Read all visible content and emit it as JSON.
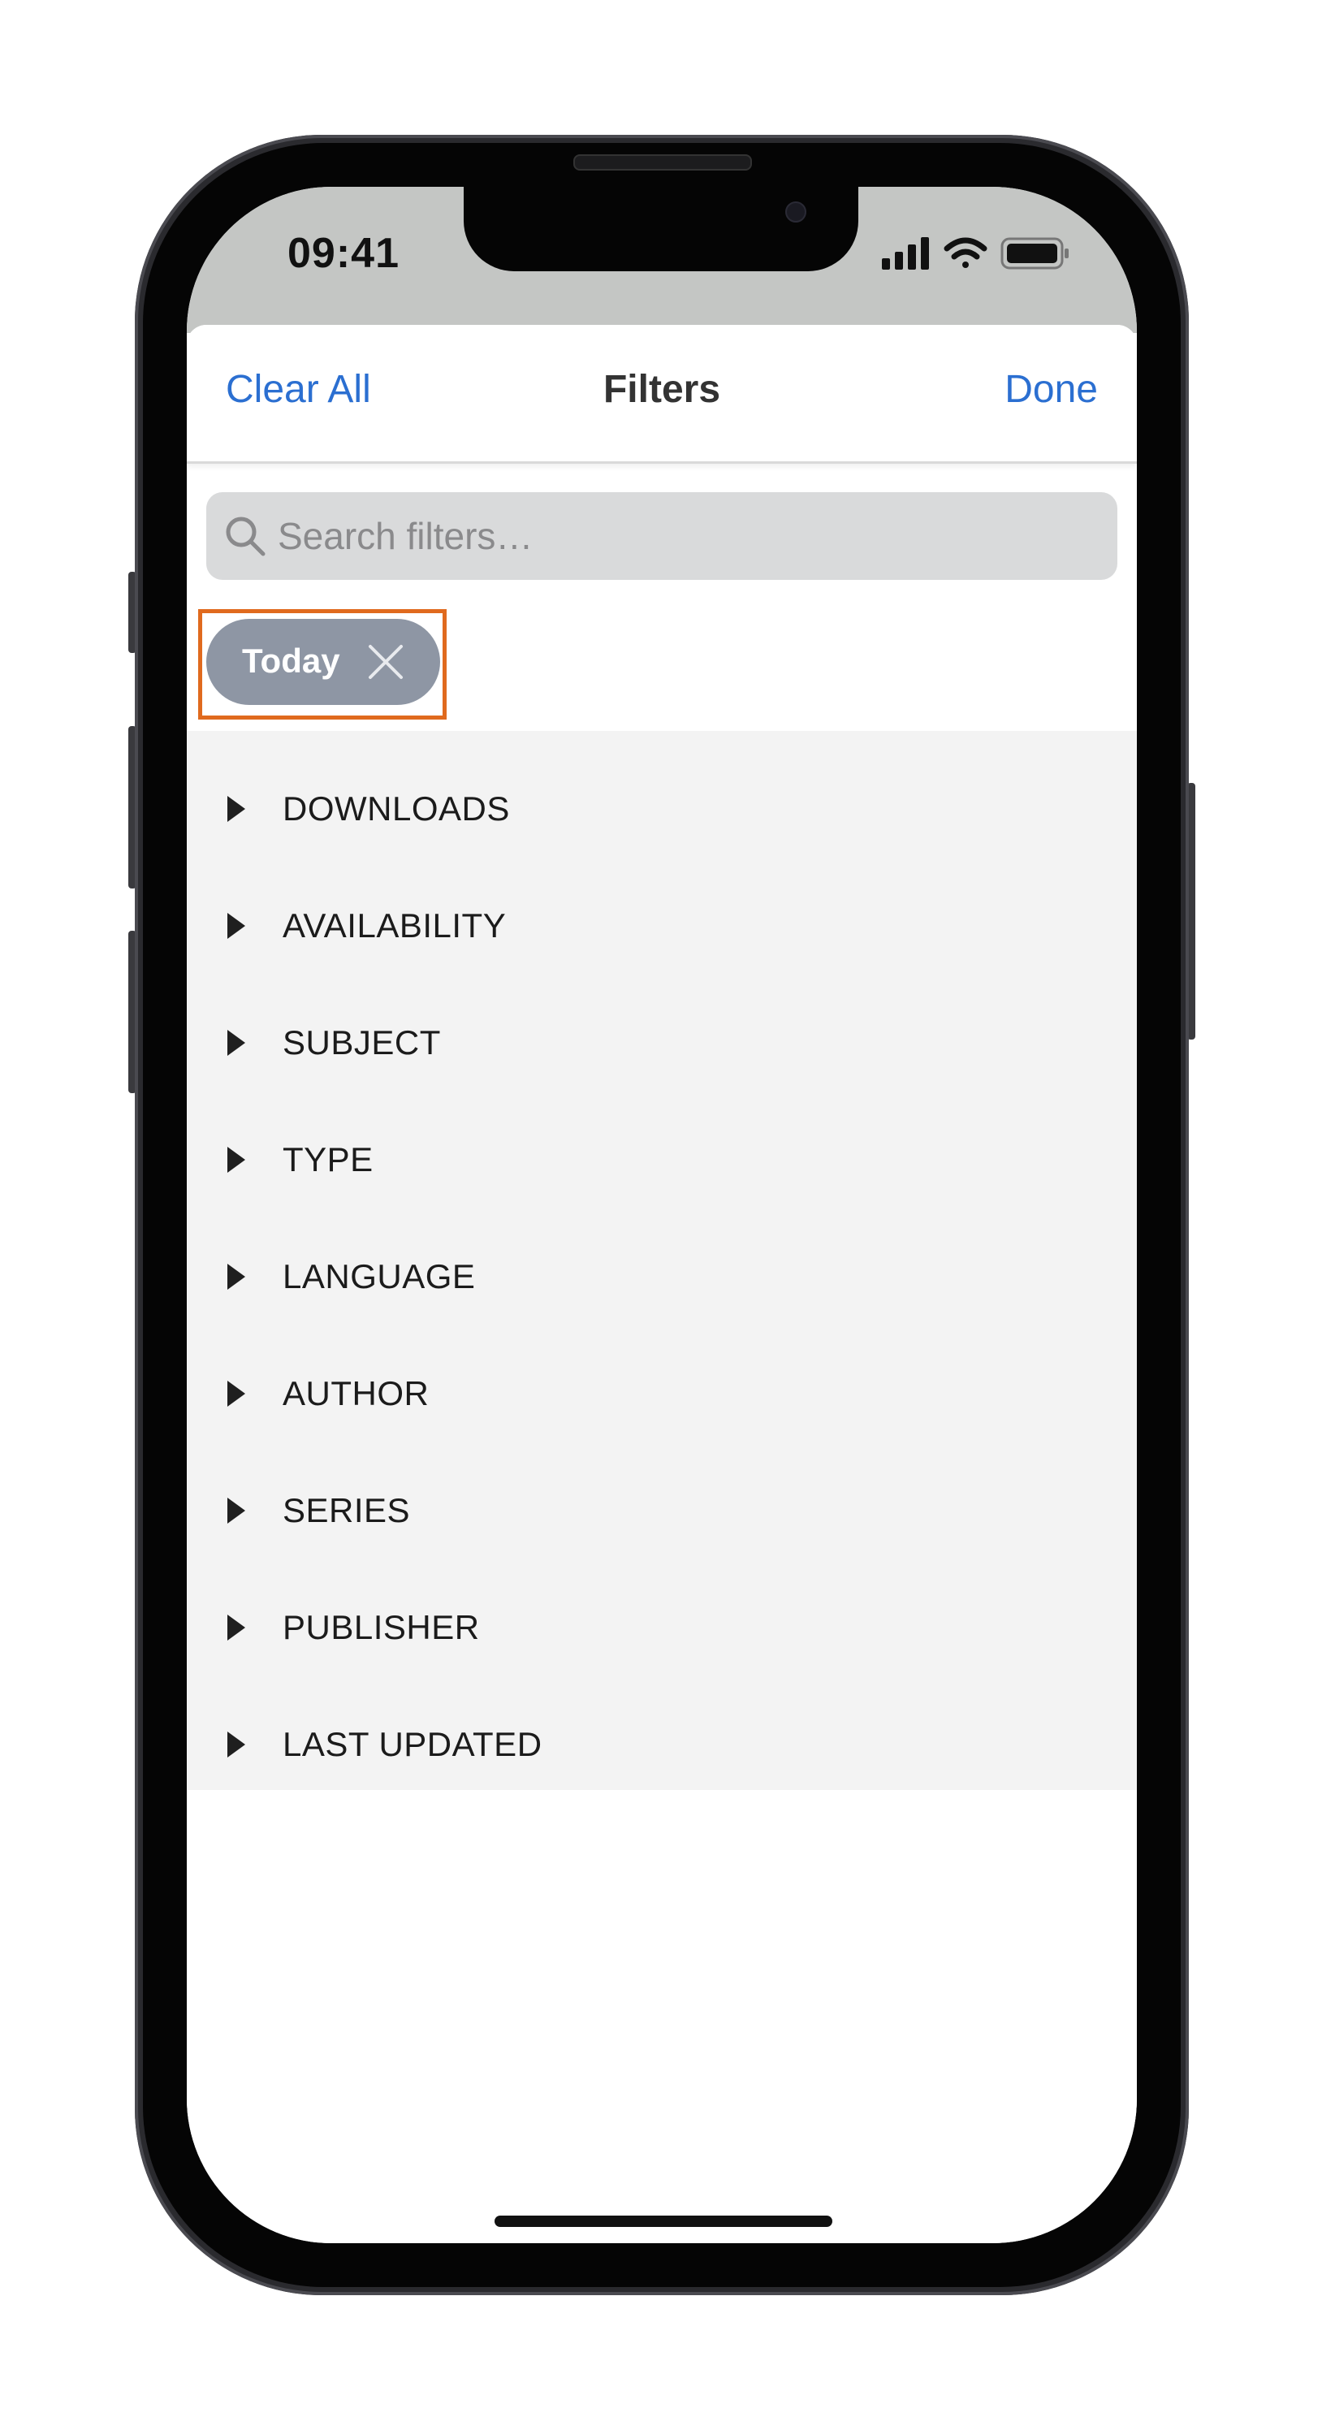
{
  "status_bar": {
    "time": "09:41"
  },
  "nav": {
    "clear_all_label": "Clear All",
    "title": "Filters",
    "done_label": "Done"
  },
  "search": {
    "placeholder": "Search filters…",
    "value": ""
  },
  "active_filters": [
    {
      "label": "Today"
    }
  ],
  "filter_sections": [
    {
      "label": "DOWNLOADS"
    },
    {
      "label": "AVAILABILITY"
    },
    {
      "label": "SUBJECT"
    },
    {
      "label": "TYPE"
    },
    {
      "label": "LANGUAGE"
    },
    {
      "label": "AUTHOR"
    },
    {
      "label": "SERIES"
    },
    {
      "label": "PUBLISHER"
    },
    {
      "label": "LAST UPDATED"
    }
  ],
  "colors": {
    "accent": "#2b6fd1",
    "chip_background": "#8e96a4",
    "highlight_border": "#e06a1e",
    "list_background": "#f3f3f3"
  },
  "icons": {
    "search": "search-icon",
    "chip_remove": "close-icon",
    "section_toggle": "caret-right-icon",
    "signal": "cellular-signal-icon",
    "wifi": "wifi-icon",
    "battery": "battery-icon"
  }
}
